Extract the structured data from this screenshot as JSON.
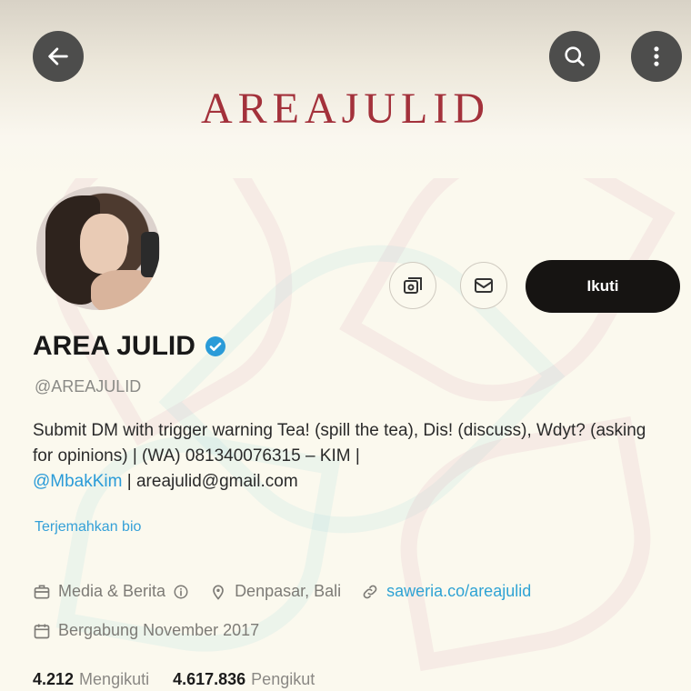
{
  "banner": {
    "title": "AREAJULID"
  },
  "profile": {
    "name": "AREA JULID",
    "handle": "@AREAJULID",
    "bio_part1": "Submit DM with trigger warning Tea! (spill the tea), Dis! (discuss), Wdyt? (asking for opinions) | (WA) 081340076315 – KIM |",
    "bio_mention": "@MbakKim",
    "bio_part2": " | areajulid@gmail.com",
    "translate": "Terjemahkan bio",
    "category": "Media & Berita",
    "location": "Denpasar, Bali",
    "link": "saweria.co/areajulid",
    "joined": "Bergabung November 2017"
  },
  "actions": {
    "follow_label": "Ikuti"
  },
  "stats": {
    "following_count": "4.212",
    "following_label": "Mengikuti",
    "followers_count": "4.617.836",
    "followers_label": "Pengikut"
  },
  "icons": [
    "back-arrow-icon",
    "search-icon",
    "more-vertical-icon",
    "notification-bell-icon",
    "mail-icon",
    "verified-badge-icon",
    "briefcase-icon",
    "location-pin-icon",
    "link-icon",
    "calendar-icon"
  ],
  "colors": {
    "banner_title": "#a3313b",
    "link": "#2fa3d4",
    "follow_bg": "#161412",
    "verified": "#2a9bd8"
  }
}
